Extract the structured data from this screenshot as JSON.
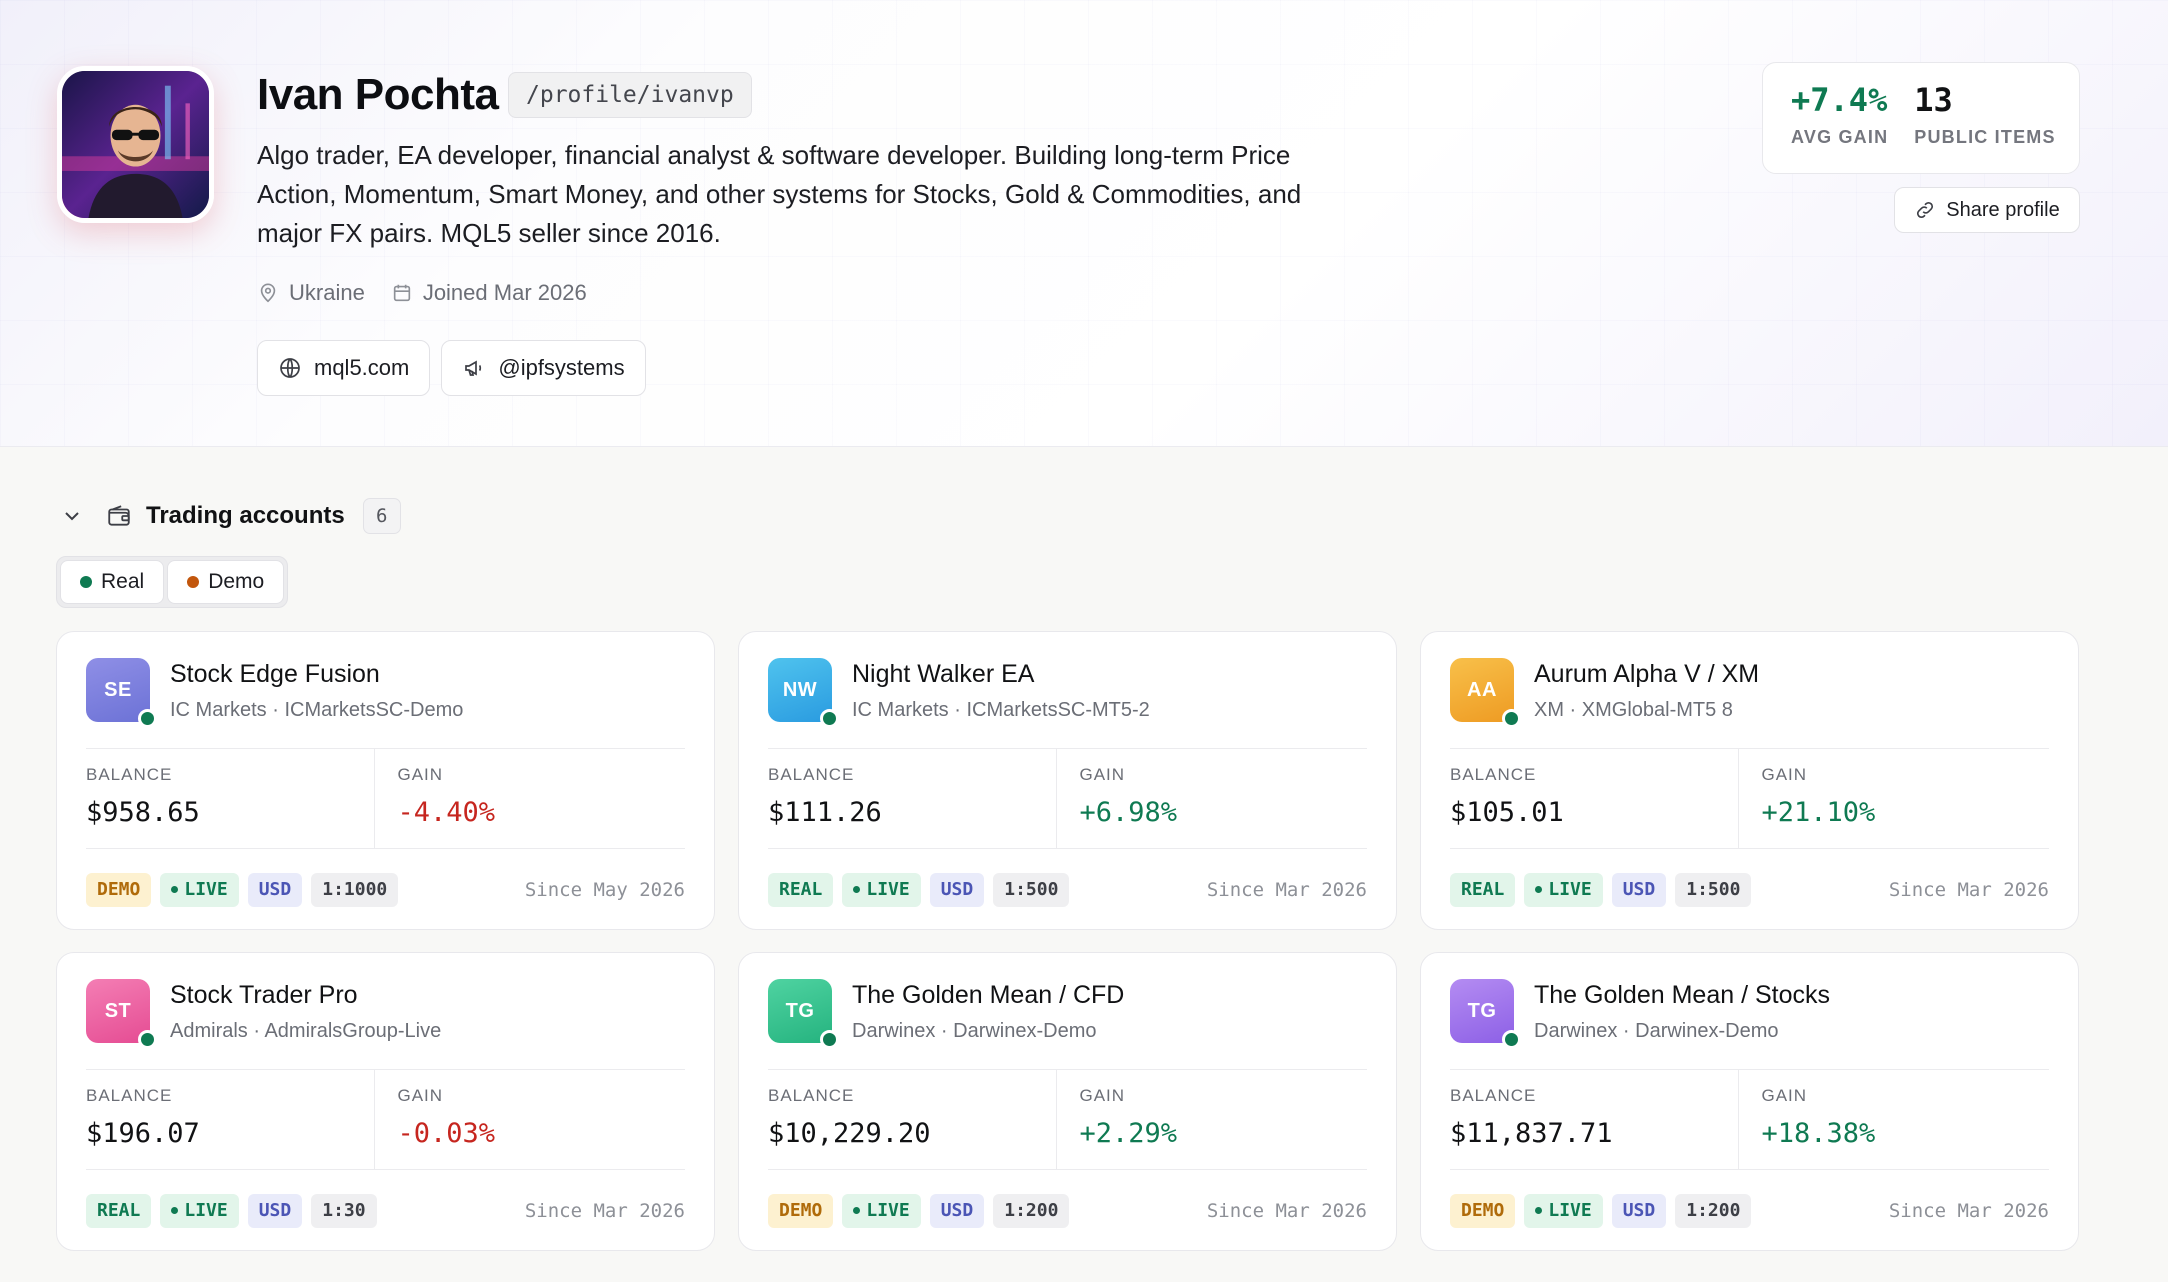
{
  "profile": {
    "name": "Ivan Pochta",
    "handle": "/profile/ivanvp",
    "bio": "Algo trader, EA developer, financial analyst & software developer. Building long-term Price Action, Momentum, Smart Money, and other systems for Stocks, Gold & Commodities, and major FX pairs. MQL5 seller since 2016.",
    "location": "Ukraine",
    "joined": "Joined Mar 2026",
    "links": [
      {
        "label": "mql5.com",
        "icon": "globe-icon"
      },
      {
        "label": "@ipfsystems",
        "icon": "megaphone-icon"
      }
    ]
  },
  "stats": {
    "avg_gain_value": "+7.4%",
    "avg_gain_label": "AVG GAIN",
    "public_items_value": "13",
    "public_items_label": "PUBLIC ITEMS",
    "share_label": "Share profile"
  },
  "section": {
    "title": "Trading accounts",
    "count": "6",
    "filters": [
      {
        "label": "Real",
        "color": "#0f7a52"
      },
      {
        "label": "Demo",
        "color": "#c2560c"
      }
    ]
  },
  "labels": {
    "balance": "BALANCE",
    "gain": "GAIN"
  },
  "accounts": [
    {
      "initials": "SE",
      "name": "Stock Edge Fusion",
      "sub": "IC Markets · ICMarketsSC-Demo",
      "balance": "$958.65",
      "gain": "-4.40%",
      "gain_sign": "neg",
      "type": "DEMO",
      "type_class": "demo",
      "live": "LIVE",
      "currency": "USD",
      "leverage": "1:1000",
      "since": "Since May 2026",
      "colors": [
        "#8f8fe6",
        "#6c72d6"
      ]
    },
    {
      "initials": "NW",
      "name": "Night Walker EA",
      "sub": "IC Markets · ICMarketsSC-MT5-2",
      "balance": "$111.26",
      "gain": "+6.98%",
      "gain_sign": "pos",
      "type": "REAL",
      "type_class": "real",
      "live": "LIVE",
      "currency": "USD",
      "leverage": "1:500",
      "since": "Since Mar 2026",
      "colors": [
        "#4fc3ee",
        "#2a9be0"
      ]
    },
    {
      "initials": "AA",
      "name": "Aurum Alpha V / XM",
      "sub": "XM · XMGlobal-MT5 8",
      "balance": "$105.01",
      "gain": "+21.10%",
      "gain_sign": "pos",
      "type": "REAL",
      "type_class": "real",
      "live": "LIVE",
      "currency": "USD",
      "leverage": "1:500",
      "since": "Since Mar 2026",
      "colors": [
        "#f8c04a",
        "#ee9b23"
      ]
    },
    {
      "initials": "ST",
      "name": "Stock Trader Pro",
      "sub": "Admirals · AdmiralsGroup-Live",
      "balance": "$196.07",
      "gain": "-0.03%",
      "gain_sign": "neg",
      "type": "REAL",
      "type_class": "real",
      "live": "LIVE",
      "currency": "USD",
      "leverage": "1:30",
      "since": "Since Mar 2026",
      "colors": [
        "#f47eb4",
        "#e54c93"
      ]
    },
    {
      "initials": "TG",
      "name": "The Golden Mean / CFD",
      "sub": "Darwinex · Darwinex-Demo",
      "balance": "$10,229.20",
      "gain": "+2.29%",
      "gain_sign": "pos",
      "type": "DEMO",
      "type_class": "demo",
      "live": "LIVE",
      "currency": "USD",
      "leverage": "1:200",
      "since": "Since Mar 2026",
      "colors": [
        "#4fd3a1",
        "#25b37f"
      ]
    },
    {
      "initials": "TG",
      "name": "The Golden Mean / Stocks",
      "sub": "Darwinex · Darwinex-Demo",
      "balance": "$11,837.71",
      "gain": "+18.38%",
      "gain_sign": "pos",
      "type": "DEMO",
      "type_class": "demo",
      "live": "LIVE",
      "currency": "USD",
      "leverage": "1:200",
      "since": "Since Mar 2026",
      "colors": [
        "#b48cf2",
        "#8d60e6"
      ]
    }
  ]
}
